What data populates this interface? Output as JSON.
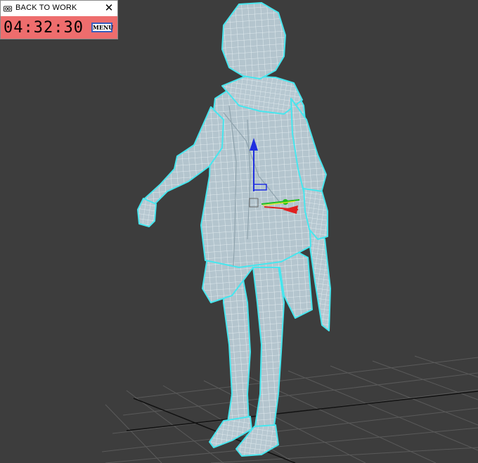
{
  "timer_window": {
    "title": "BACK TO WORK",
    "close_glyph": "✕",
    "time": "04:32:30",
    "menu_label": "MENU",
    "icon": "camera-icon",
    "body_color": "#ee6d6d"
  },
  "viewport": {
    "background_color": "#3d3d3d",
    "mesh_fill_color": "#b4c5ce",
    "wire_color": "#eef6f8",
    "selection_outline_color": "#47e6ee",
    "gizmo": {
      "x_axis_color": "#e02020",
      "y_axis_color": "#20c020",
      "z_axis_color": "#1f2fe0"
    }
  }
}
